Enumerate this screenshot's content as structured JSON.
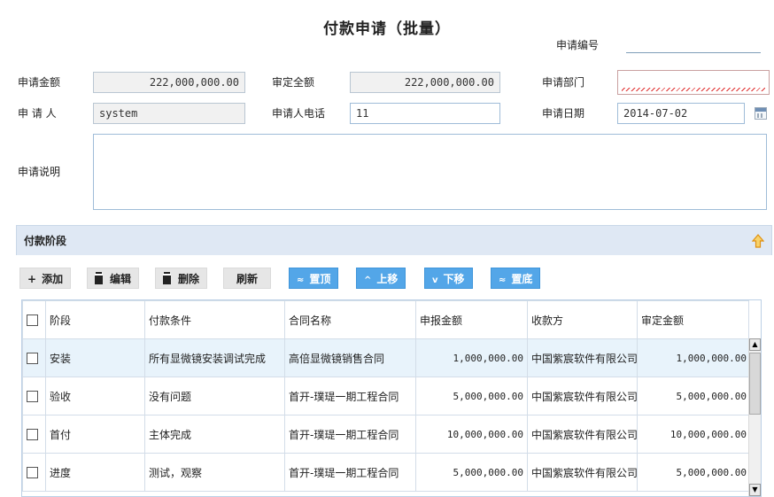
{
  "form": {
    "title": "付款申请（批量）",
    "application_no_label": "申请编号",
    "application_no_value": "",
    "amount_label": "申请金额",
    "amount_value": "222,000,000.00",
    "approved_amount_label": "审定全额",
    "approved_amount_value": "222,000,000.00",
    "department_label": "申请部门",
    "department_value": "",
    "applicant_label": "申 请 人",
    "applicant_value": "system",
    "phone_label": "申请人电话",
    "phone_value": "11",
    "date_label": "申请日期",
    "date_value": "2014-07-02",
    "desc_label": "申请说明",
    "desc_value": ""
  },
  "panel": {
    "title": "付款阶段"
  },
  "toolbar": {
    "add": "添加",
    "edit": "编辑",
    "delete": "删除",
    "refresh": "刷新",
    "top": "置顶",
    "up": "上移",
    "down": "下移",
    "bottom": "置底"
  },
  "icons": {
    "add": "plus-icon",
    "edit": "trash-icon",
    "delete": "trash-icon",
    "top": "double-chevron-up-icon",
    "up": "chevron-up-icon",
    "down": "chevron-down-icon",
    "bottom": "double-chevron-down-icon",
    "collapse": "arrow-up-icon",
    "calendar": "calendar-icon"
  },
  "grid": {
    "headers": [
      "阶段",
      "付款条件",
      "合同名称",
      "申报金额",
      "收款方",
      "审定金额"
    ],
    "rows": [
      {
        "stage": "安装",
        "condition": "所有显微镜安装调试完成",
        "contract": "高倍显微镜销售合同",
        "declared": "1,000,000.00",
        "payee": "中国紫宸软件有限公司",
        "approved": "1,000,000.00"
      },
      {
        "stage": "验收",
        "condition": "没有问题",
        "contract": "首开-璞瑅一期工程合同",
        "declared": "5,000,000.00",
        "payee": "中国紫宸软件有限公司",
        "approved": "5,000,000.00"
      },
      {
        "stage": "首付",
        "condition": "主体完成",
        "contract": "首开-璞瑅一期工程合同",
        "declared": "10,000,000.00",
        "payee": "中国紫宸软件有限公司",
        "approved": "10,000,000.00"
      },
      {
        "stage": "进度",
        "condition": "测试，观察",
        "contract": "首开-璞瑅一期工程合同",
        "declared": "5,000,000.00",
        "payee": "中国紫宸软件有限公司",
        "approved": "5,000,000.00"
      }
    ]
  },
  "colors": {
    "accent_blue": "#53a6e8",
    "panel_header": "#dfe8f4",
    "selected_row": "#e8f3fb",
    "collapse_icon": "#f0a020"
  }
}
